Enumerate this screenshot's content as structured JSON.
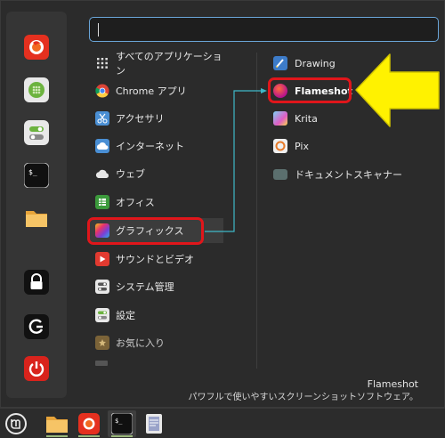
{
  "search": {
    "placeholder": "",
    "value": ""
  },
  "favorites": [
    {
      "name": "firefox-icon"
    },
    {
      "name": "software-manager-icon"
    },
    {
      "name": "settings-toggle-icon"
    },
    {
      "name": "terminal-icon"
    },
    {
      "name": "folder-icon"
    },
    {
      "name": "lock-icon"
    },
    {
      "name": "logout-icon"
    },
    {
      "name": "power-icon"
    }
  ],
  "categories": [
    {
      "label": "すべてのアプリケーション"
    },
    {
      "label": "Chrome アプリ"
    },
    {
      "label": "アクセサリ"
    },
    {
      "label": "インターネット"
    },
    {
      "label": "ウェブ"
    },
    {
      "label": "オフィス"
    },
    {
      "label": "グラフィックス"
    },
    {
      "label": "サウンドとビデオ"
    },
    {
      "label": "システム管理"
    },
    {
      "label": "設定"
    },
    {
      "label": "お気に入り"
    }
  ],
  "apps": [
    {
      "label": "Drawing"
    },
    {
      "label": "Flameshot"
    },
    {
      "label": "Krita"
    },
    {
      "label": "Pix"
    },
    {
      "label": "ドキュメントスキャナー"
    }
  ],
  "description": {
    "title": "Flameshot",
    "text": "パワフルで使いやすいスクリーンショットソフトウェア。"
  },
  "colors": {
    "highlight_box": "#e0161b",
    "arrow_fill": "#fff200",
    "connector": "#3fb8c8",
    "search_border": "#6aa5d8"
  },
  "taskbar": [
    {
      "name": "mint-menu-icon"
    },
    {
      "name": "folder-icon"
    },
    {
      "name": "firefox-icon"
    },
    {
      "name": "terminal-icon"
    },
    {
      "name": "text-editor-icon"
    }
  ]
}
